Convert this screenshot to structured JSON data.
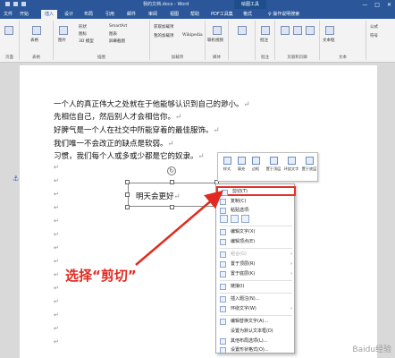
{
  "window": {
    "title": "我的文档.docx - Word",
    "context_tab_group": "绘图工具",
    "controls": [
      "—",
      "□",
      "✕"
    ]
  },
  "tabs": {
    "file": "文件",
    "home": "开始",
    "insert": "插入",
    "design": "设计",
    "layout": "布局",
    "references": "引用",
    "mailings": "邮件",
    "review": "审阅",
    "view": "视图",
    "help": "帮助",
    "pdf": "PDF工具集",
    "format": "格式",
    "tellme": "操作说明搜索"
  },
  "ribbon": {
    "pages_label": "页面",
    "table_btn": "表格",
    "tables_label": "表格",
    "picture_btn": "图片",
    "shapes_btn": "形状",
    "icons_btn": "图标",
    "threed_btn": "3D 模型",
    "smartart_btn": "SmartArt",
    "chart_btn": "图表",
    "screenshot_btn": "屏幕截图",
    "illustrations_label": "插图",
    "get_addins": "获取加载项",
    "my_addins": "我的加载项",
    "wikipedia": "Wikipedia",
    "addins_label": "加载项",
    "online_video": "联机视频",
    "media_label": "媒体",
    "comments_btn": "批注",
    "comments_label": "批注",
    "header_footer_label": "页眉和页脚",
    "textbox_btn": "文本框",
    "text_label": "文本",
    "symbols": "公式",
    "symbol": "符号"
  },
  "document": {
    "paragraphs": [
      "一个人的真正伟大之处就在于他能够认识到自己的渺小。",
      "先相信自己，然后别人才会相信你。",
      "好脾气是一个人在社交中所能穿着的最佳服饰。",
      "我们唯一不会改正的缺点是软弱。",
      "习惯，我们每个人或多或少都是它的奴隶。"
    ],
    "textbox_text": "明天会更好",
    "para_mark": "↵",
    "anchor_icon": "anchor-icon"
  },
  "mini_toolbar": {
    "style": "样式",
    "fill": "填充",
    "outline": "边框",
    "front": "置于顶层",
    "wrap": "环绕文字",
    "bottom": "置于底层"
  },
  "context_menu": {
    "cut": "剪切(T)",
    "copy": "复制(C)",
    "paste_options": "粘贴选项:",
    "edit_text": "编辑文字(X)",
    "edit_points": "编辑顶点(E)",
    "group": "组合(G)",
    "bring_front": "置于顶层(R)",
    "send_back": "置于底层(K)",
    "link": "链接(I)",
    "insert_caption": "插入题注(N)...",
    "wrap_text": "环绕文字(W)",
    "edit_alt_text": "编辑替换文字(A)...",
    "set_default": "设置为默认文本框(D)",
    "more_layout": "其他布局选项(L)...",
    "format_shape": "设置形状格式(O)..."
  },
  "annotation": {
    "callout_text": "选择“剪切”",
    "color": "#e02b20"
  },
  "watermark": "Baidu经验",
  "colors": {
    "accent": "#2b579a",
    "highlight_red": "#e02b20"
  }
}
